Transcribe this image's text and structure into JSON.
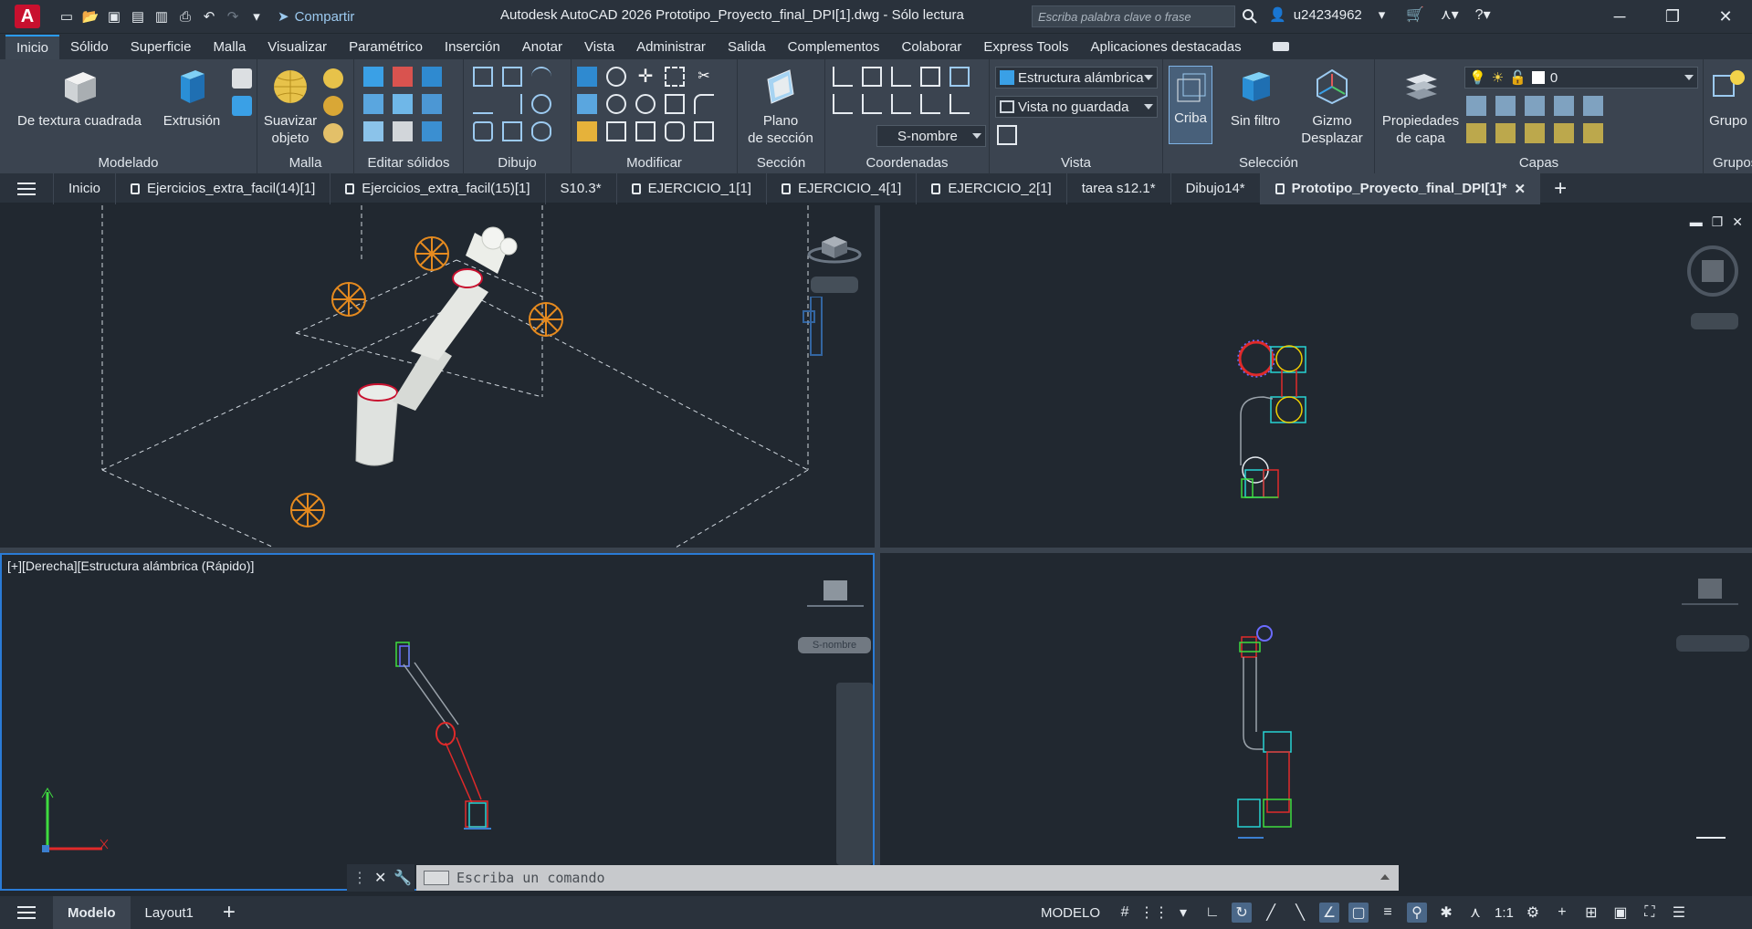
{
  "titlebar": {
    "app_logo": "A",
    "share_label": "Compartir",
    "title": "Autodesk AutoCAD 2026    Prototipo_Proyecto_final_DPI[1].dwg - Sólo lectura",
    "search_placeholder": "Escriba palabra clave o frase",
    "username": "u24234962"
  },
  "ribbon_tabs": [
    "Inicio",
    "Sólido",
    "Superficie",
    "Malla",
    "Visualizar",
    "Paramétrico",
    "Inserción",
    "Anotar",
    "Vista",
    "Administrar",
    "Salida",
    "Complementos",
    "Colaborar",
    "Express Tools",
    "Aplicaciones destacadas"
  ],
  "ribbon": {
    "modelado": {
      "title": "Modelado",
      "box": "De textura cuadrada",
      "extrusion": "Extrusión"
    },
    "malla": {
      "title": "Malla",
      "smooth": "Suavizar\nobjeto"
    },
    "editar_solidos": {
      "title": "Editar sólidos"
    },
    "dibujo": {
      "title": "Dibujo"
    },
    "modificar": {
      "title": "Modificar"
    },
    "seccion": {
      "title": "Sección",
      "plane": "Plano\nde sección"
    },
    "coordenadas": {
      "title": "Coordenadas",
      "ucs_name": "S-nombre"
    },
    "vista": {
      "title": "Vista",
      "visual_style": "Estructura alámbrica",
      "named_view": "Vista no guardada"
    },
    "seleccion": {
      "title": "Selección",
      "criba": "Criba",
      "filter": "Sin filtro",
      "gizmo": "Gizmo\nDesplazar"
    },
    "capas": {
      "title": "Capas",
      "layer_props": "Propiedades\nde capa",
      "current_layer": "0"
    },
    "grupo": {
      "title": "Grupos",
      "label": "Grupo"
    }
  },
  "doc_tabs": [
    {
      "label": "Inicio",
      "locked": false
    },
    {
      "label": "Ejercicios_extra_facil(14)[1]",
      "locked": true
    },
    {
      "label": "Ejercicios_extra_facil(15)[1]",
      "locked": true
    },
    {
      "label": "S10.3*",
      "locked": false
    },
    {
      "label": "EJERCICIO_1[1]",
      "locked": true
    },
    {
      "label": "EJERCICIO_4[1]",
      "locked": true
    },
    {
      "label": "EJERCICIO_2[1]",
      "locked": true
    },
    {
      "label": "tarea s12.1*",
      "locked": false
    },
    {
      "label": "Dibujo14*",
      "locked": false
    },
    {
      "label": "Prototipo_Proyecto_final_DPI[1]*",
      "locked": true,
      "active": true
    }
  ],
  "viewports": {
    "bottom_left_label": "[+][Derecha][Estructura alámbrica (Rápido)]",
    "ucs_label_lower": "S-nombre"
  },
  "command_line": {
    "placeholder": "Escriba un comando"
  },
  "status": {
    "tabs": [
      "Modelo",
      "Layout1"
    ],
    "space": "MODELO",
    "scale": "1:1"
  },
  "colors": {
    "accent": "#2a9bf2",
    "bg": "#212830",
    "ribbon": "#3b4450"
  }
}
